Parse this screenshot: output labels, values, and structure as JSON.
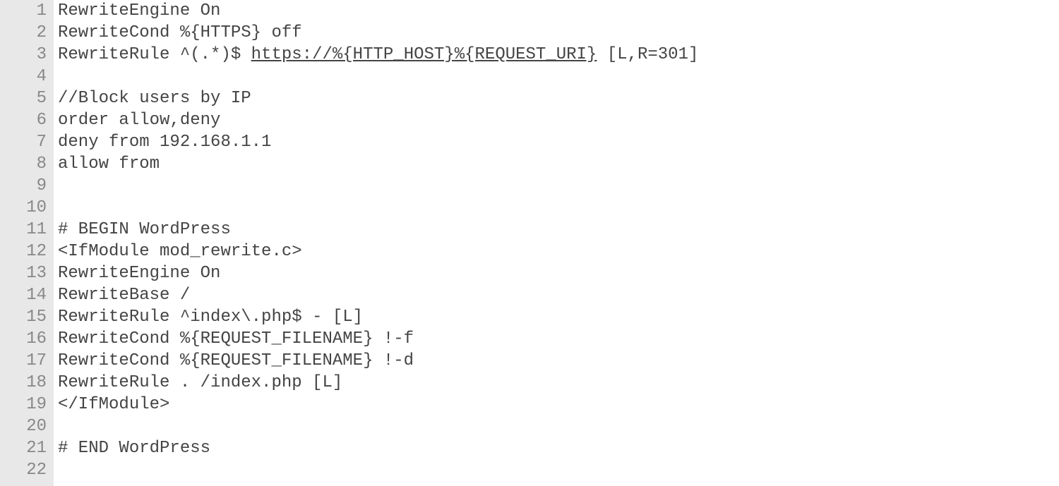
{
  "lines": [
    {
      "num": "1",
      "segments": [
        {
          "text": "RewriteEngine On"
        }
      ]
    },
    {
      "num": "2",
      "segments": [
        {
          "text": "RewriteCond %{HTTPS} off"
        }
      ]
    },
    {
      "num": "3",
      "segments": [
        {
          "text": "RewriteRule ^(.*)$ "
        },
        {
          "text": "https://%{HTTP_HOST}%{REQUEST_URI}",
          "underline": true
        },
        {
          "text": " [L,R=301]"
        }
      ]
    },
    {
      "num": "4",
      "segments": [
        {
          "text": ""
        }
      ]
    },
    {
      "num": "5",
      "segments": [
        {
          "text": "//Block users by IP"
        }
      ]
    },
    {
      "num": "6",
      "segments": [
        {
          "text": "order allow,deny"
        }
      ]
    },
    {
      "num": "7",
      "segments": [
        {
          "text": "deny from 192.168.1.1"
        }
      ]
    },
    {
      "num": "8",
      "segments": [
        {
          "text": "allow from"
        }
      ]
    },
    {
      "num": "9",
      "segments": [
        {
          "text": ""
        }
      ]
    },
    {
      "num": "10",
      "segments": [
        {
          "text": ""
        }
      ]
    },
    {
      "num": "11",
      "segments": [
        {
          "text": "# BEGIN WordPress"
        }
      ]
    },
    {
      "num": "12",
      "segments": [
        {
          "text": "<IfModule mod_rewrite.c>"
        }
      ]
    },
    {
      "num": "13",
      "segments": [
        {
          "text": "RewriteEngine On"
        }
      ]
    },
    {
      "num": "14",
      "segments": [
        {
          "text": "RewriteBase /"
        }
      ]
    },
    {
      "num": "15",
      "segments": [
        {
          "text": "RewriteRule ^index\\.php$ - [L]"
        }
      ]
    },
    {
      "num": "16",
      "segments": [
        {
          "text": "RewriteCond %{REQUEST_FILENAME} !-f"
        }
      ]
    },
    {
      "num": "17",
      "segments": [
        {
          "text": "RewriteCond %{REQUEST_FILENAME} !-d"
        }
      ]
    },
    {
      "num": "18",
      "segments": [
        {
          "text": "RewriteRule . /index.php [L]"
        }
      ]
    },
    {
      "num": "19",
      "segments": [
        {
          "text": "</IfModule>"
        }
      ]
    },
    {
      "num": "20",
      "segments": [
        {
          "text": ""
        }
      ]
    },
    {
      "num": "21",
      "segments": [
        {
          "text": "# END WordPress"
        }
      ]
    },
    {
      "num": "22",
      "segments": [
        {
          "text": ""
        }
      ]
    }
  ]
}
